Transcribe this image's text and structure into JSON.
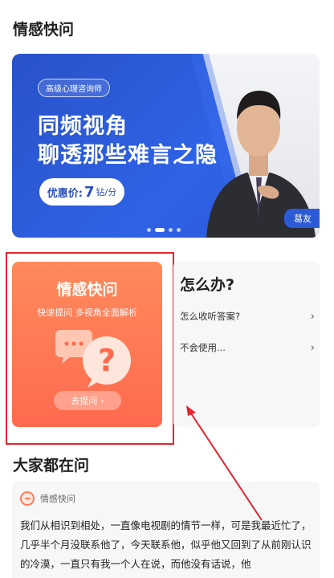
{
  "header": {
    "title": "情感快问"
  },
  "banner": {
    "tag": "高级心理咨询师",
    "line1": "同频视角",
    "line2": "聊透那些难言之隐",
    "price_label": "优惠价:",
    "price_value": "7",
    "price_unit": "钻/分",
    "badge": "葛友",
    "colors": {
      "primary": "#2f62e6"
    }
  },
  "card": {
    "title": "情感快问",
    "subtitle": "快速提问 多视角全面解析",
    "button_label": "去提问",
    "button_chevron": "›",
    "icons": [
      "chat-bubble-icon",
      "question-bubble-icon"
    ],
    "colors": {
      "top": "#ff8a5b",
      "bottom": "#ff6a4e"
    }
  },
  "help": {
    "title": "怎么办?",
    "items": [
      {
        "label": "怎么收听答案?",
        "chevron": "›"
      },
      {
        "label": "不会使用...",
        "chevron": "›"
      }
    ]
  },
  "section2": {
    "title": "大家都在问"
  },
  "question": {
    "category": "情感快问",
    "text": "我们从相识到相处，一直像电视剧的情节一样，可是我最近忙了，几乎半个月没联系他了，今天联系他，似乎他又回到了从前刚认识的冷漠，一直只有我一个人在说，而他没有话说，他"
  },
  "annotation": {
    "highlight_color": "#e2262f"
  }
}
